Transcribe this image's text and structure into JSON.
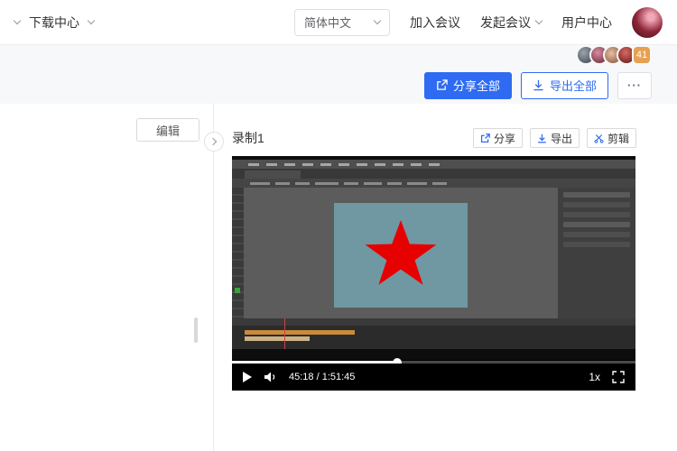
{
  "header": {
    "title": "下载中心",
    "language": "简体中文",
    "join_meeting": "加入会议",
    "start_meeting": "发起会议",
    "user_center": "用户中心"
  },
  "participants": {
    "count_badge": "41"
  },
  "toolbar": {
    "share_all": "分享全部",
    "export_all": "导出全部",
    "more": "···"
  },
  "sidebar": {
    "edit": "编辑"
  },
  "content": {
    "title": "录制1",
    "actions": [
      {
        "label": "分享"
      },
      {
        "label": "导出"
      },
      {
        "label": "剪辑"
      }
    ]
  },
  "player": {
    "time": "45:18 / 1:51:45",
    "speed": "1x",
    "progress_percent": 41
  },
  "colors": {
    "accent": "#2e6bf2",
    "badge": "#e5a050",
    "star": "#e60000",
    "stage": "#6f98a2"
  }
}
